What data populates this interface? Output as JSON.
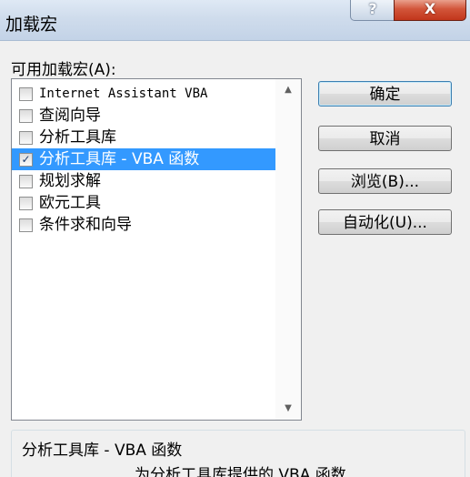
{
  "window": {
    "title": "加载宏",
    "help_glyph": "?",
    "close_glyph": "X"
  },
  "addins": {
    "label": "可用加载宏(A):",
    "items": [
      {
        "label": "Internet Assistant VBA",
        "checked": false,
        "selected": false
      },
      {
        "label": "查阅向导",
        "checked": false,
        "selected": false
      },
      {
        "label": "分析工具库",
        "checked": false,
        "selected": false
      },
      {
        "label": "分析工具库 - VBA 函数",
        "checked": true,
        "selected": true
      },
      {
        "label": "规划求解",
        "checked": false,
        "selected": false
      },
      {
        "label": "欧元工具",
        "checked": false,
        "selected": false
      },
      {
        "label": "条件求和向导",
        "checked": false,
        "selected": false
      }
    ],
    "check_glyph": "✓"
  },
  "buttons": {
    "ok": "确定",
    "cancel": "取消",
    "browse": "浏览(B)...",
    "automation": "自动化(U)..."
  },
  "description": {
    "title": "分析工具库 - VBA 函数",
    "text": "为分析工具库提供的 VBA 函数"
  },
  "colors": {
    "selection": "#3399ff",
    "close_button": "#c2361b"
  }
}
